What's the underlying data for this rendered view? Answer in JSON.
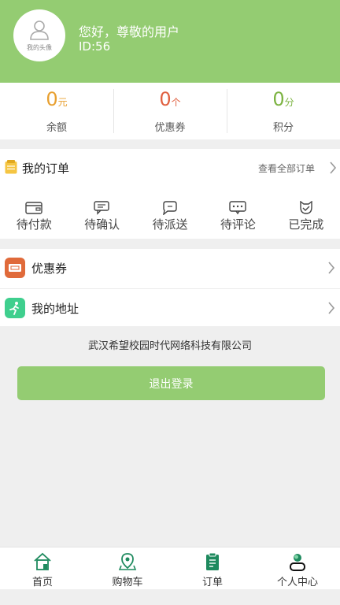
{
  "profile": {
    "avatar_label": "我的头像",
    "greeting": "您好，尊敬的用户",
    "user_id": "ID:56"
  },
  "stats": [
    {
      "value": "0",
      "unit": "元",
      "label": "余额",
      "color": "#e8a030"
    },
    {
      "value": "0",
      "unit": "个",
      "label": "优惠券",
      "color": "#e06040"
    },
    {
      "value": "0",
      "unit": "分",
      "label": "积分",
      "color": "#7cb342"
    }
  ],
  "orders": {
    "title": "我的订单",
    "view_all": "查看全部订单",
    "items": [
      {
        "label": "待付款",
        "icon": "wallet-icon"
      },
      {
        "label": "待确认",
        "icon": "chat-icon"
      },
      {
        "label": "待派送",
        "icon": "delivery-icon"
      },
      {
        "label": "待评论",
        "icon": "comment-icon"
      },
      {
        "label": "已完成",
        "icon": "completed-icon"
      }
    ]
  },
  "menu": [
    {
      "label": "优惠券",
      "icon": "coupon-icon",
      "color": "#e06a3a"
    },
    {
      "label": "我的地址",
      "icon": "runner-icon",
      "color": "#3fcf8e"
    }
  ],
  "company": "武汉希望校园时代网络科技有限公司",
  "logout_label": "退出登录",
  "tabbar": [
    {
      "label": "首页",
      "icon": "home-icon"
    },
    {
      "label": "购物车",
      "icon": "location-icon"
    },
    {
      "label": "订单",
      "icon": "clipboard-icon"
    },
    {
      "label": "个人中心",
      "icon": "person-icon"
    }
  ],
  "colors": {
    "accent": "#94cc72",
    "tab_icon": "#1e8a5e"
  }
}
